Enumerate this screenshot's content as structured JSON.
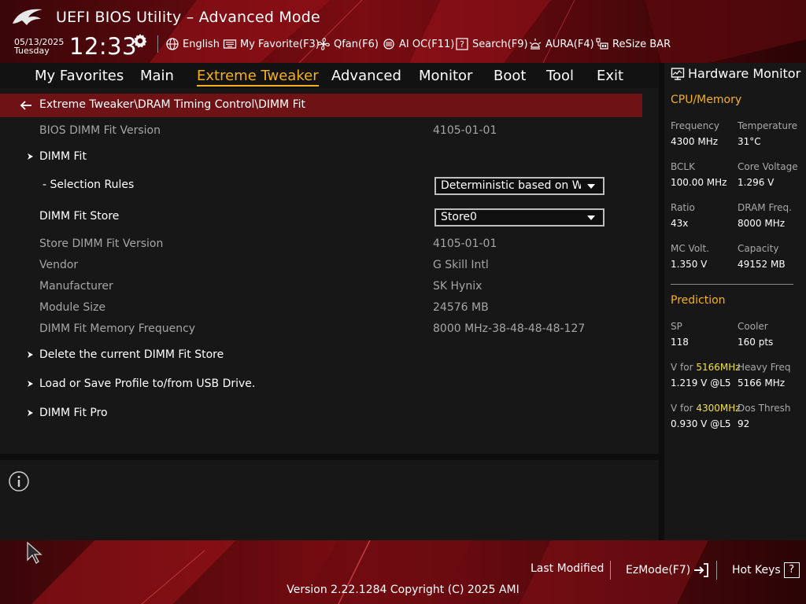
{
  "header": {
    "title": "UEFI BIOS Utility – Advanced Mode",
    "date": "05/13/2025",
    "day": "Tuesday",
    "time": "12:33",
    "tools": [
      {
        "label": "English",
        "icon": "globe-icon"
      },
      {
        "label": "My Favorite(F3)",
        "icon": "keyboard-icon"
      },
      {
        "label": "Qfan(F6)",
        "icon": "fan-icon"
      },
      {
        "label": "AI OC(F11)",
        "icon": "ai-chip-icon"
      },
      {
        "label": "Search(F9)",
        "icon": "question-search-icon"
      },
      {
        "label": "AURA(F4)",
        "icon": "aura-light-icon"
      },
      {
        "label": "ReSize BAR",
        "icon": "resize-bar-icon"
      }
    ]
  },
  "menu": {
    "tabs": [
      "My Favorites",
      "Main",
      "Extreme Tweaker",
      "Advanced",
      "Monitor",
      "Boot",
      "Tool",
      "Exit"
    ],
    "active": "Extreme Tweaker"
  },
  "main": {
    "breadcrumb": "Extreme Tweaker\\DRAM Timing Control\\DIMM Fit",
    "bios_version": {
      "label": "BIOS DIMM Fit Version",
      "value": "4105-01-01"
    },
    "dimm_fit": "DIMM Fit",
    "selection_rules": {
      "label": "- Selection Rules",
      "value": "Deterministic based on Wo"
    },
    "store": {
      "label": "DIMM Fit Store",
      "value": "Store0"
    },
    "store_version": {
      "label": "Store DIMM Fit Version",
      "value": "4105-01-01"
    },
    "vendor": {
      "label": "Vendor",
      "value": "G Skill Intl"
    },
    "manufacturer": {
      "label": "Manufacturer",
      "value": "SK Hynix"
    },
    "module_size": {
      "label": "Module Size",
      "value": "24576 MB"
    },
    "memory_frequency": {
      "label": "DIMM Fit Memory Frequency",
      "value": "8000 MHz-38-48-48-48-127"
    },
    "delete_store": "Delete the current DIMM Fit Store",
    "load_save_profile": "Load or Save Profile to/from USB Drive.",
    "dimm_fit_pro": "DIMM Fit Pro"
  },
  "hardware_monitor": {
    "title": "Hardware Monitor",
    "cpu_memory": {
      "heading": "CPU/Memory",
      "frequency": {
        "label": "Frequency",
        "value": "4300 MHz"
      },
      "temperature": {
        "label": "Temperature",
        "value": "31°C"
      },
      "bclk": {
        "label": "BCLK",
        "value": "100.00 MHz"
      },
      "core_voltage": {
        "label": "Core Voltage",
        "value": "1.296 V"
      },
      "ratio": {
        "label": "Ratio",
        "value": "43x"
      },
      "dram_freq": {
        "label": "DRAM Freq.",
        "value": "8000 MHz"
      },
      "mc_volt": {
        "label": "MC Volt.",
        "value": "1.350 V"
      },
      "capacity": {
        "label": "Capacity",
        "value": "49152 MB"
      }
    },
    "prediction": {
      "heading": "Prediction",
      "sp": {
        "label": "SP",
        "value": "118"
      },
      "cooler": {
        "label": "Cooler",
        "value": "160 pts"
      },
      "v_for_1": {
        "prefix": "V for ",
        "freq": "5166MHz",
        "value": "1.219 V @L5"
      },
      "heavy_freq": {
        "label": "Heavy Freq",
        "value": "5166 MHz"
      },
      "v_for_2": {
        "prefix": "V for ",
        "freq": "4300MHz",
        "value": "0.930 V @L5"
      },
      "dos_thresh": {
        "label": "Dos Thresh",
        "value": "92"
      }
    }
  },
  "footer": {
    "last_modified": "Last Modified",
    "ezmode": "EzMode(F7)",
    "hot_keys": "Hot Keys",
    "hot_keys_glyph": "?",
    "version": "Version 2.22.1284 Copyright (C) 2025 AMI"
  },
  "colors": {
    "accent": "#f7b018",
    "breadcrumb_bg": "#6e1216",
    "predict_highlight": "#f2e13a"
  }
}
